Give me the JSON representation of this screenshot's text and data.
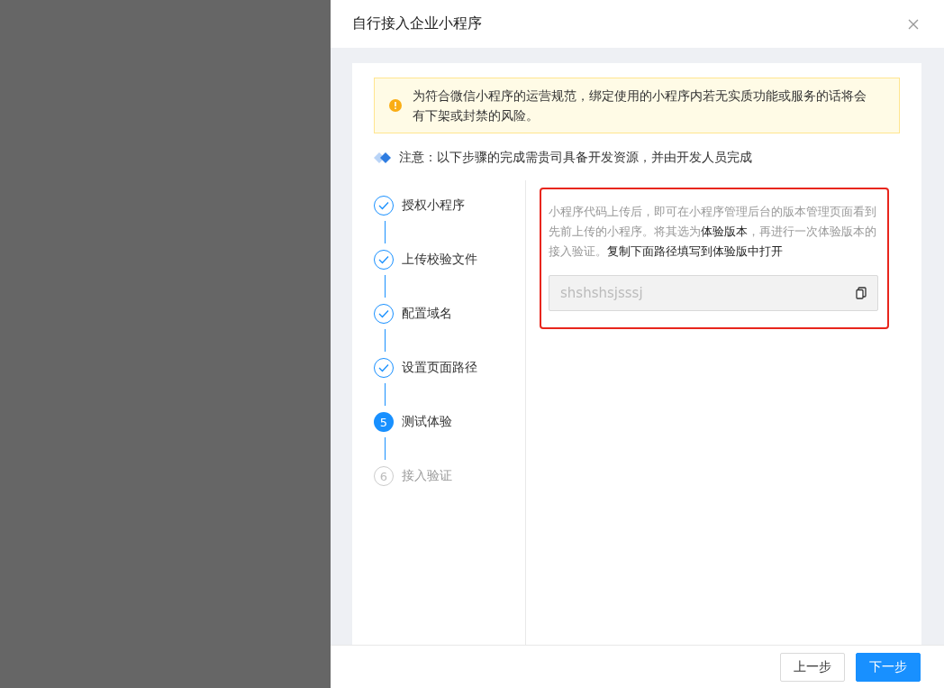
{
  "drawer": {
    "title": "自行接入企业小程序"
  },
  "alert": {
    "text": "为符合微信小程序的运营规范，绑定使用的小程序内若无实质功能或服务的话将会有下架或封禁的风险。"
  },
  "notice": {
    "text": "注意：以下步骤的完成需贵司具备开发资源，并由开发人员完成"
  },
  "steps": [
    {
      "label": "授权小程序",
      "kind": "finished"
    },
    {
      "label": "上传校验文件",
      "kind": "finished"
    },
    {
      "label": "配置域名",
      "kind": "finished"
    },
    {
      "label": "设置页面路径",
      "kind": "finished"
    },
    {
      "label": "测试体验",
      "number": "5",
      "kind": "active"
    },
    {
      "label": "接入验证",
      "number": "6",
      "kind": "waiting"
    }
  ],
  "content": {
    "description": "小程序代码上传后，即可在小程序管理后台的版本管理页面看到先前上传的小程序。将其选为**体验版本**，再进行一次体验版本的接入验证。**复制下面路径填写到体验版中打开**",
    "path_field": {
      "value": "shshshsjsssj",
      "disabled": true
    }
  },
  "footer": {
    "buttons": [
      {
        "label": "上一步",
        "kind": "default"
      },
      {
        "label": "下一步",
        "kind": "primary"
      }
    ]
  }
}
